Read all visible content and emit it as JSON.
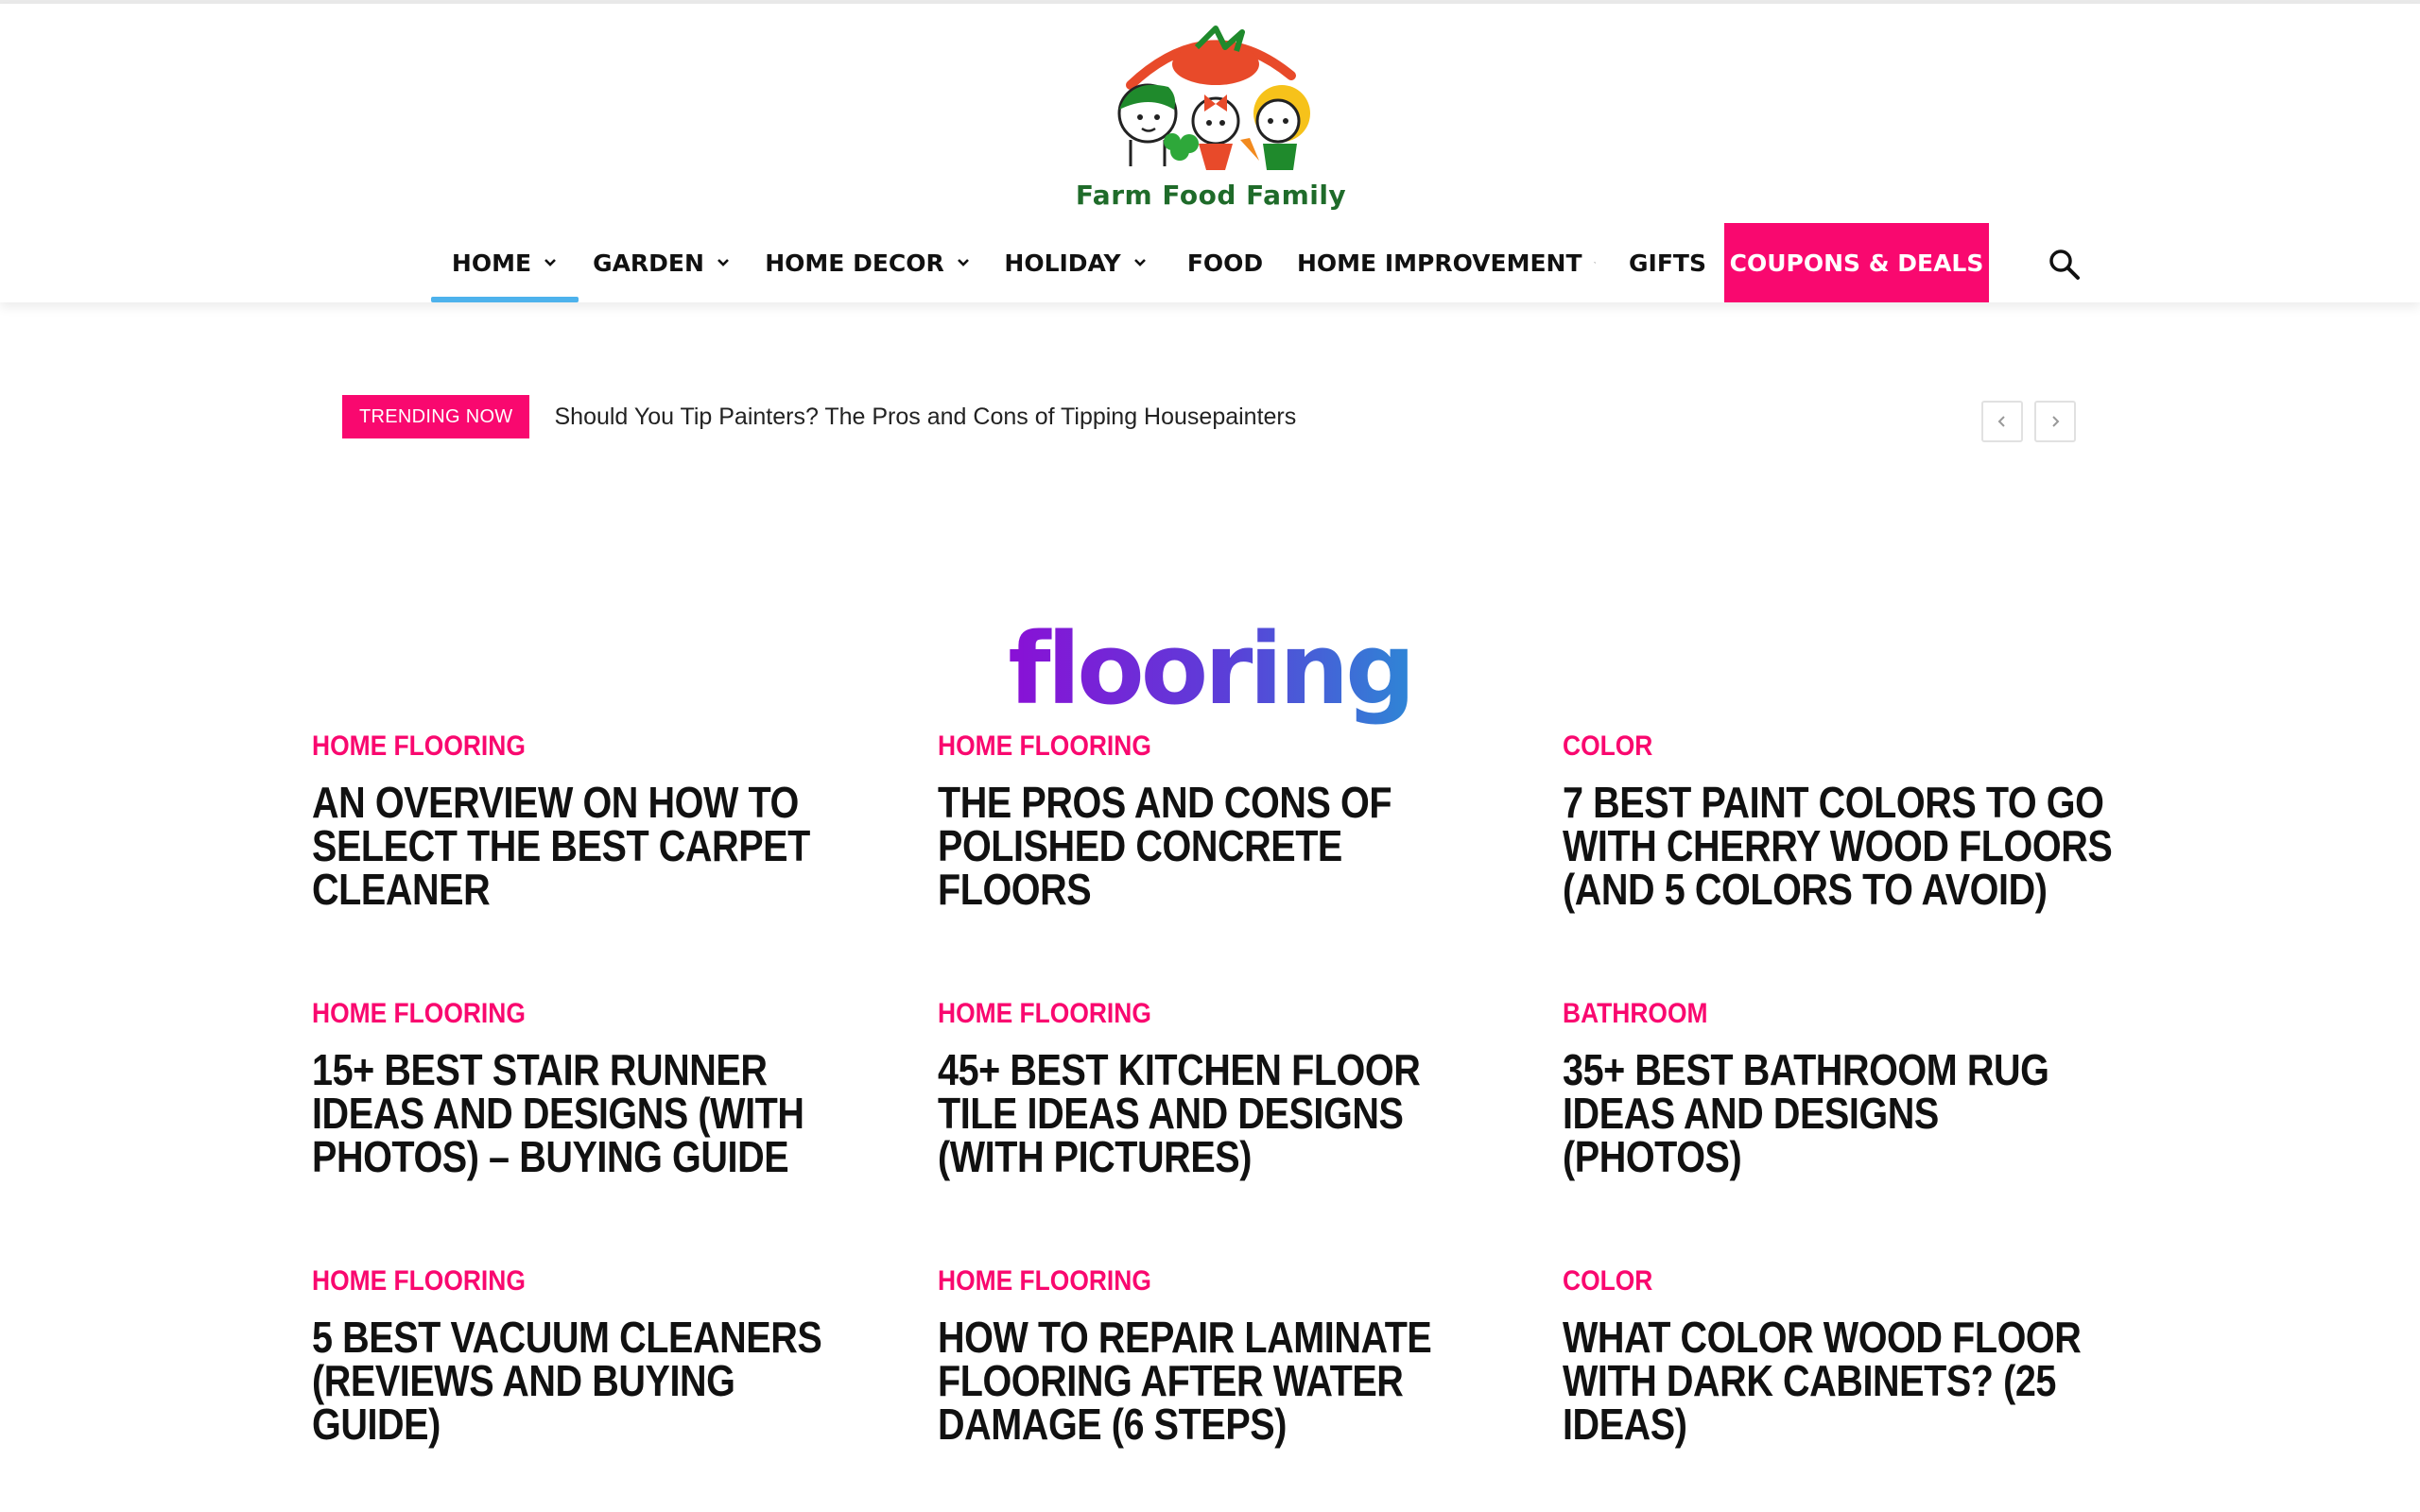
{
  "brand": {
    "name": "Farm Food Family"
  },
  "nav": {
    "items": [
      {
        "label": "HOME",
        "has_dropdown": true,
        "active": true
      },
      {
        "label": "GARDEN",
        "has_dropdown": true
      },
      {
        "label": "HOME DECOR",
        "has_dropdown": true
      },
      {
        "label": "HOLIDAY",
        "has_dropdown": true
      },
      {
        "label": "FOOD",
        "has_dropdown": false
      },
      {
        "label": "HOME IMPROVEMENT",
        "has_dropdown": true
      },
      {
        "label": "GIFTS",
        "has_dropdown": false
      },
      {
        "label": "COUPONS & DEALS",
        "has_dropdown": false,
        "highlight": true
      }
    ],
    "search_icon": "search-icon"
  },
  "trending": {
    "badge": "TRENDING NOW",
    "headline": "Should You Tip Painters? The Pros and Cons of Tipping Housepainters"
  },
  "category": {
    "title": "flooring"
  },
  "articles": [
    {
      "category": "HOME FLOORING",
      "title": "AN OVERVIEW ON HOW TO SELECT THE BEST CARPET CLEANER"
    },
    {
      "category": "HOME FLOORING",
      "title": "THE PROS AND CONS OF POLISHED CONCRETE FLOORS"
    },
    {
      "category": "COLOR",
      "title": "7 BEST PAINT COLORS TO GO WITH CHERRY WOOD FLOORS (AND 5 COLORS TO AVOID)"
    },
    {
      "category": "HOME FLOORING",
      "title": "15+ BEST STAIR RUNNER IDEAS AND DESIGNS (WITH PHOTOS) – BUYING GUIDE"
    },
    {
      "category": "HOME FLOORING",
      "title": "45+ BEST KITCHEN FLOOR TILE IDEAS AND DESIGNS (WITH PICTURES)"
    },
    {
      "category": "BATHROOM",
      "title": "35+ BEST BATHROOM RUG IDEAS AND DESIGNS (PHOTOS)"
    },
    {
      "category": "HOME FLOORING",
      "title": "5 BEST VACUUM CLEANERS (REVIEWS AND BUYING GUIDE)"
    },
    {
      "category": "HOME FLOORING",
      "title": "HOW TO REPAIR LAMINATE FLOORING AFTER WATER DAMAGE (6 STEPS)"
    },
    {
      "category": "COLOR",
      "title": "WHAT COLOR WOOD FLOOR WITH DARK CABINETS? (25 IDEAS)"
    }
  ],
  "colors": {
    "accent_pink": "#f9086f",
    "active_underline": "#4db2ec",
    "title_gradient_start": "#8a10d6",
    "title_gradient_end": "#2e86d6"
  }
}
